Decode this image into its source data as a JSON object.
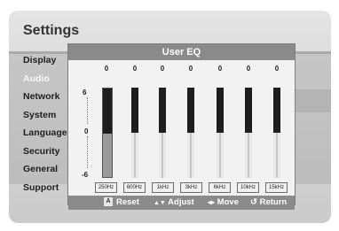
{
  "settings": {
    "title": "Settings",
    "menu": [
      "Display",
      "Audio",
      "Network",
      "System",
      "Language",
      "Security",
      "General",
      "Support"
    ],
    "active_item": "Audio"
  },
  "dialog": {
    "title": "User EQ",
    "scale": {
      "top": "6",
      "mid": "0",
      "bottom": "-6"
    },
    "bands": [
      {
        "freq": "250Hz",
        "value": "0",
        "selected": true
      },
      {
        "freq": "600Hz",
        "value": "0",
        "selected": false
      },
      {
        "freq": "1kHz",
        "value": "0",
        "selected": false
      },
      {
        "freq": "3kHz",
        "value": "0",
        "selected": false
      },
      {
        "freq": "6kHz",
        "value": "0",
        "selected": false
      },
      {
        "freq": "10kHz",
        "value": "0",
        "selected": false
      },
      {
        "freq": "15kHz",
        "value": "0",
        "selected": false
      }
    ],
    "footer": {
      "reset_key": "A",
      "reset": "Reset",
      "adjust_icon": "▲▼",
      "adjust": "Adjust",
      "move_icon": "◂▸",
      "move": "Move",
      "return_icon": "↺",
      "return": "Return"
    }
  }
}
